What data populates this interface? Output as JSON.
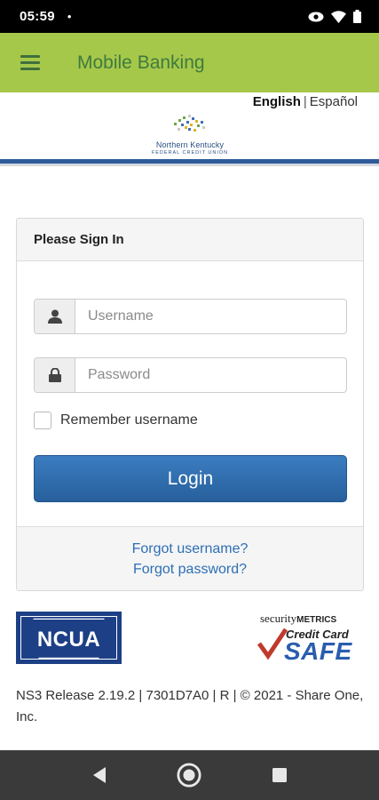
{
  "status_bar": {
    "time": "05:59",
    "dot": "•"
  },
  "app_bar": {
    "title": "Mobile Banking"
  },
  "language": {
    "english": "English",
    "separator": "|",
    "spanish": "Español"
  },
  "logo": {
    "line1": "Northern Kentucky",
    "line2": "FEDERAL CREDIT UNION"
  },
  "signin": {
    "heading": "Please Sign In",
    "username_placeholder": "Username",
    "password_placeholder": "Password",
    "remember_label": "Remember username",
    "login_label": "Login",
    "forgot_username": "Forgot username?",
    "forgot_password": "Forgot password?"
  },
  "badges": {
    "ncua_text": "NCUA",
    "security_prefix": "security",
    "security_suffix": "METRICS",
    "credit_card": "Credit Card",
    "safe": "SAFE"
  },
  "footer": {
    "release": "NS3 Release 2.19.2 | 7301D7A0 | R | © 2021 - Share One, Inc."
  },
  "colors": {
    "appbar": "#a6c84a",
    "title": "#3f7a3f",
    "button": "#2e6aa8",
    "link": "#2d6fb5",
    "rule": "#2e5c9a"
  }
}
